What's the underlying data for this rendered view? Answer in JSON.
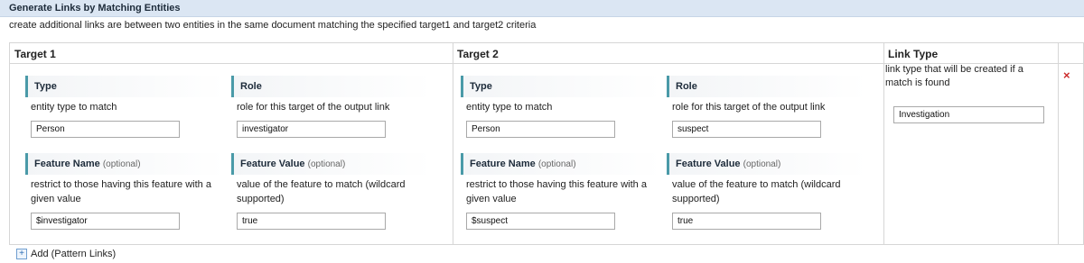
{
  "header": {
    "title": "Generate Links by Matching Entities"
  },
  "description": "create additional links are between two entities in the same document matching the specified target1 and target2 criteria",
  "columns": {
    "target1": "Target 1",
    "target2": "Target 2",
    "link_type": "Link Type"
  },
  "target1": {
    "type": {
      "label": "Type",
      "desc": "entity type to match",
      "value": "Person"
    },
    "role": {
      "label": "Role",
      "desc": "role for this target of the output link",
      "value": "investigator"
    },
    "feature_name": {
      "label": "Feature Name",
      "optional": "(optional)",
      "desc": "restrict to those having this feature with a given value",
      "value": "$investigator"
    },
    "feature_value": {
      "label": "Feature Value",
      "optional": "(optional)",
      "desc": "value of the feature to match (wildcard supported)",
      "value": "true"
    }
  },
  "target2": {
    "type": {
      "label": "Type",
      "desc": "entity type to match",
      "value": "Person"
    },
    "role": {
      "label": "Role",
      "desc": "role for this target of the output link",
      "value": "suspect"
    },
    "feature_name": {
      "label": "Feature Name",
      "optional": "(optional)",
      "desc": "restrict to those having this feature with a given value",
      "value": "$suspect"
    },
    "feature_value": {
      "label": "Feature Value",
      "optional": "(optional)",
      "desc": "value of the feature to match (wildcard supported)",
      "value": "true"
    }
  },
  "link_type": {
    "desc": "link type that will be created if a match is found",
    "value": "Investigation"
  },
  "remove_icon": "close-icon",
  "remove_glyph": "×",
  "add": {
    "label": "Add (Pattern Links)",
    "glyph": "+"
  }
}
